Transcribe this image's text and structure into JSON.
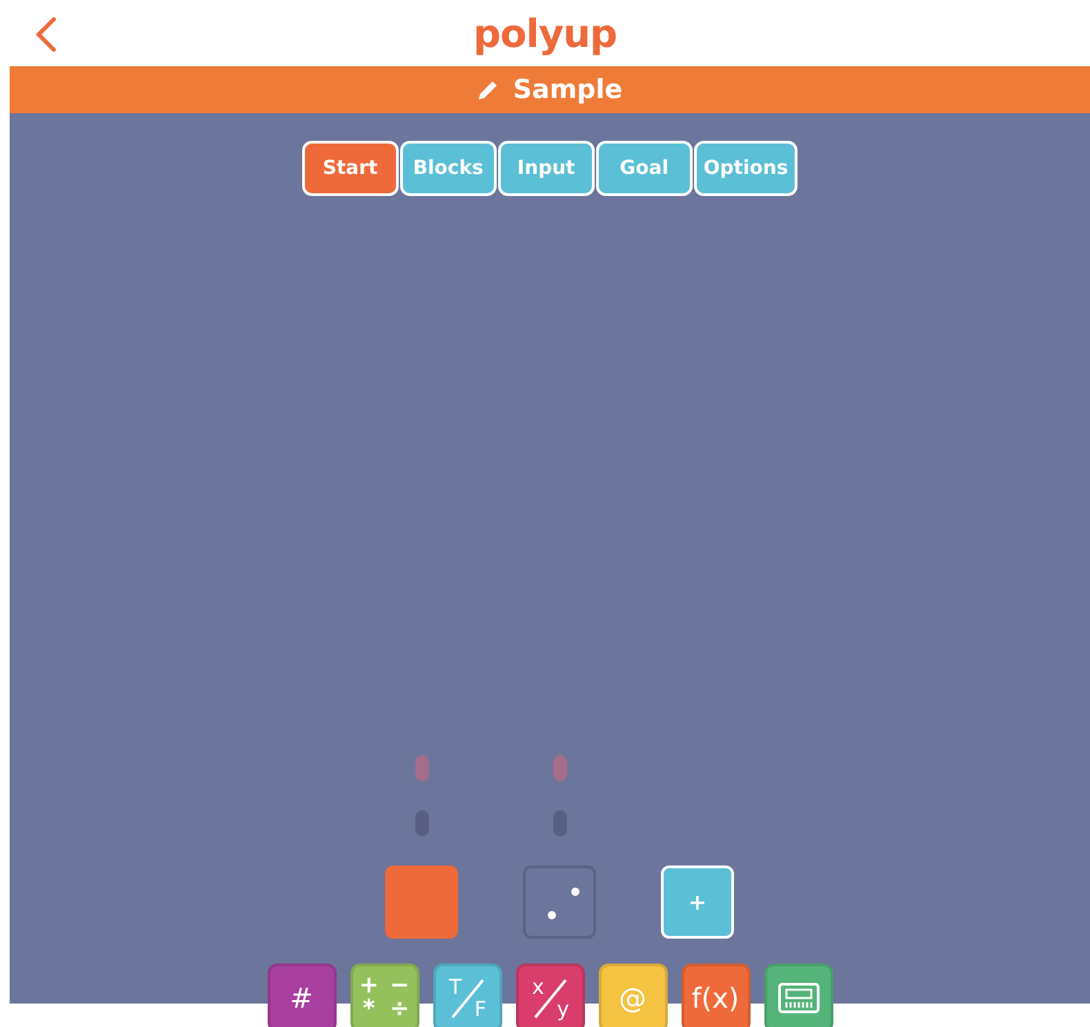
{
  "header": {
    "logo": "polyup"
  },
  "title_bar": {
    "title": "Sample"
  },
  "tabs": [
    {
      "label": "Start",
      "selected": true
    },
    {
      "label": "Blocks",
      "selected": false
    },
    {
      "label": "Input",
      "selected": false
    },
    {
      "label": "Goal",
      "selected": false
    },
    {
      "label": "Options",
      "selected": false
    }
  ],
  "blocks": [
    {
      "kind": "character"
    },
    {
      "kind": "dice"
    },
    {
      "kind": "add",
      "label": "+"
    }
  ],
  "toolbar": [
    {
      "kind": "text",
      "label": "#",
      "color": "#a83f9e"
    },
    {
      "kind": "grid",
      "glyphs": [
        "+",
        "−",
        "*",
        "÷"
      ],
      "color": "#95c15c"
    },
    {
      "kind": "fraction",
      "top": "T",
      "bottom": "F",
      "color": "#5bbfd6"
    },
    {
      "kind": "fraction",
      "top": "x",
      "bottom": "y",
      "color": "#d83d6b"
    },
    {
      "kind": "text",
      "label": "@",
      "color": "#f5c342"
    },
    {
      "kind": "text",
      "label": "f(x)",
      "color": "#ef6a3a"
    },
    {
      "kind": "keyboard",
      "color": "#55b47a"
    }
  ]
}
